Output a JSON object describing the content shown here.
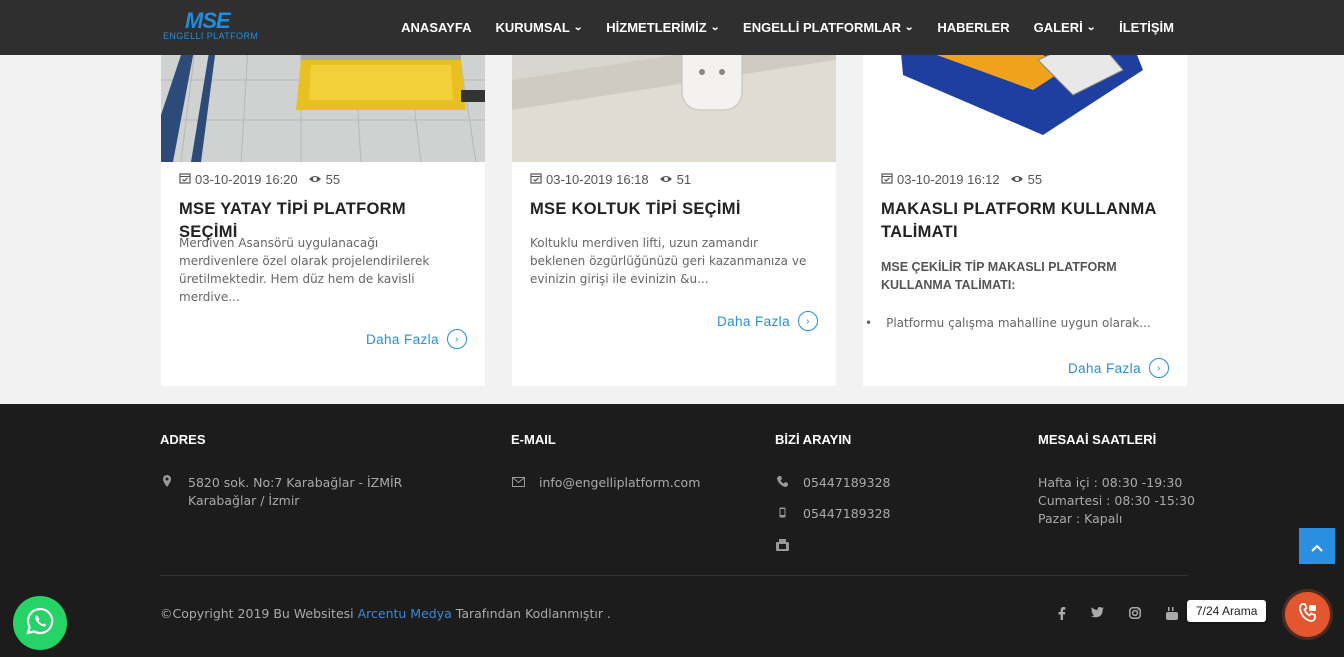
{
  "header": {
    "logo_mark": "MSE",
    "logo_sub": "ENGELLI PLATFORM",
    "nav": [
      {
        "label": "ANASAYFA",
        "dropdown": false
      },
      {
        "label": "KURUMSAL",
        "dropdown": true
      },
      {
        "label": "HİZMETLERİMİZ",
        "dropdown": true
      },
      {
        "label": "ENGELLİ PLATFORMLAR",
        "dropdown": true
      },
      {
        "label": "HABERLER",
        "dropdown": false
      },
      {
        "label": "GALERİ",
        "dropdown": true
      },
      {
        "label": "İLETİŞİM",
        "dropdown": false
      }
    ]
  },
  "cards": [
    {
      "date": "03-10-2019 16:20",
      "views": "55",
      "title": "MSE YATAY TİPİ PLATFORM SEÇİMİ",
      "description": "Merdiven Asansörü uygulanacağı merdivenlere özel olarak projelendirilerek üretilmektedir. Hem düz hem de kavisli merdive...",
      "more": "Daha Fazla"
    },
    {
      "date": "03-10-2019 16:18",
      "views": "51",
      "title": "MSE KOLTUK TİPİ SEÇİMİ",
      "description": "Koltuklu merdiven lifti, uzun zamandır beklenen özgürlüğünüzü geri kazanmanıza ve evinizin girişi ile evinizin &u...",
      "more": "Daha Fazla"
    },
    {
      "date": "03-10-2019 16:12",
      "views": "55",
      "title": "MAKASLI PLATFORM KULLANMA TALİMATI",
      "bold_description": "MSE ÇEKİLİR TİP MAKASLI PLATFORM KULLANMA TALİMATI:",
      "bullet": "Platformu çalışma mahalline uygun olarak...",
      "more": "Daha Fazla"
    }
  ],
  "footer": {
    "address": {
      "heading": "ADRES",
      "line1": "5820 sok. No:7 Karabağlar - İZMİR",
      "line2": "Karabağlar / İzmir"
    },
    "email": {
      "heading": "E-MAIL",
      "value": "info@engelliplatform.com"
    },
    "phone": {
      "heading": "BİZİ ARAYIN",
      "phone1": "05447189328",
      "phone2": "05447189328"
    },
    "hours": {
      "heading": "MESAAİ SAATLERİ",
      "line1": "Hafta içi : 08:30 -19:30",
      "line2": "Cumartesi : 08:30 -15:30",
      "line3": "Pazar : Kapalı"
    },
    "copyright_pre": "©Copyright 2019 Bu Websitesi ",
    "copyright_link": "Arcentu Medya",
    "copyright_post": " Tarafından Kodlanmıştır ."
  },
  "call_tooltip": "7/24 Arama",
  "colors": {
    "header_bg": "#2f2f2f",
    "accent_blue": "#2a8fd6",
    "footer_bg": "#1c1c1c",
    "whatsapp": "#25d366",
    "call": "#e4572e"
  },
  "icons": {
    "date": "calendar-check-icon",
    "views": "eye-icon",
    "address": "map-marker-icon",
    "email": "envelope-icon",
    "phone": "phone-icon",
    "mobile": "mobile-icon",
    "fax": "fax-icon",
    "social": [
      "facebook-icon",
      "twitter-icon",
      "instagram-icon",
      "youtube-icon"
    ]
  }
}
